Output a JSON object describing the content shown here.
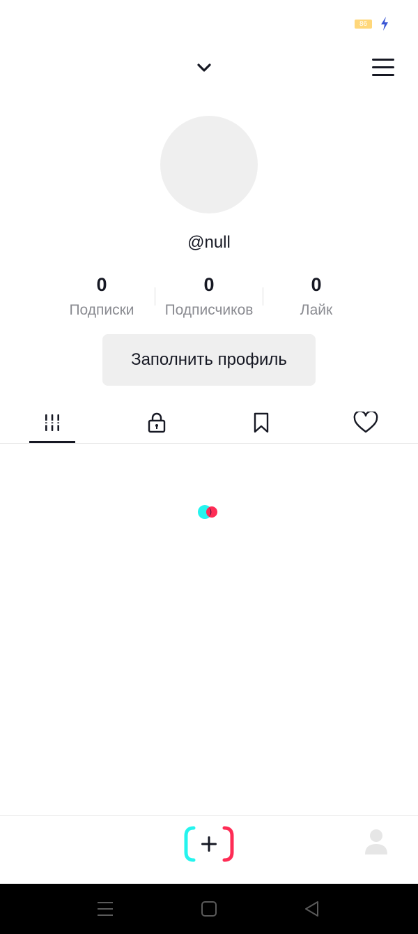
{
  "status_bar": {
    "battery_level": "86",
    "battery_color": "#ffd77a",
    "charging_icon": "lightning-bolt-icon",
    "charging_color": "#3a56d4"
  },
  "header": {
    "account_switch_icon": "chevron-down-icon",
    "menu_icon": "hamburger-menu-icon"
  },
  "profile": {
    "username": "@null",
    "stats": [
      {
        "value": "0",
        "label": "Подписки"
      },
      {
        "value": "0",
        "label": "Подписчиков"
      },
      {
        "value": "0",
        "label": "Лайк"
      }
    ],
    "fill_profile_label": "Заполнить профиль"
  },
  "tabs": [
    {
      "name": "videos",
      "icon": "grid-icon",
      "active": true
    },
    {
      "name": "private",
      "icon": "lock-icon",
      "active": false
    },
    {
      "name": "favorites",
      "icon": "bookmark-icon",
      "active": false
    },
    {
      "name": "liked",
      "icon": "heart-icon",
      "active": false
    }
  ],
  "loader": {
    "colors": [
      "#25f4ee",
      "#fe2c55"
    ]
  },
  "bottom_bar": {
    "create_icon": "create-plus-icon",
    "profile_icon": "profile-person-icon"
  },
  "system_nav": {
    "items": [
      "recents-icon",
      "home-icon",
      "back-icon"
    ]
  }
}
